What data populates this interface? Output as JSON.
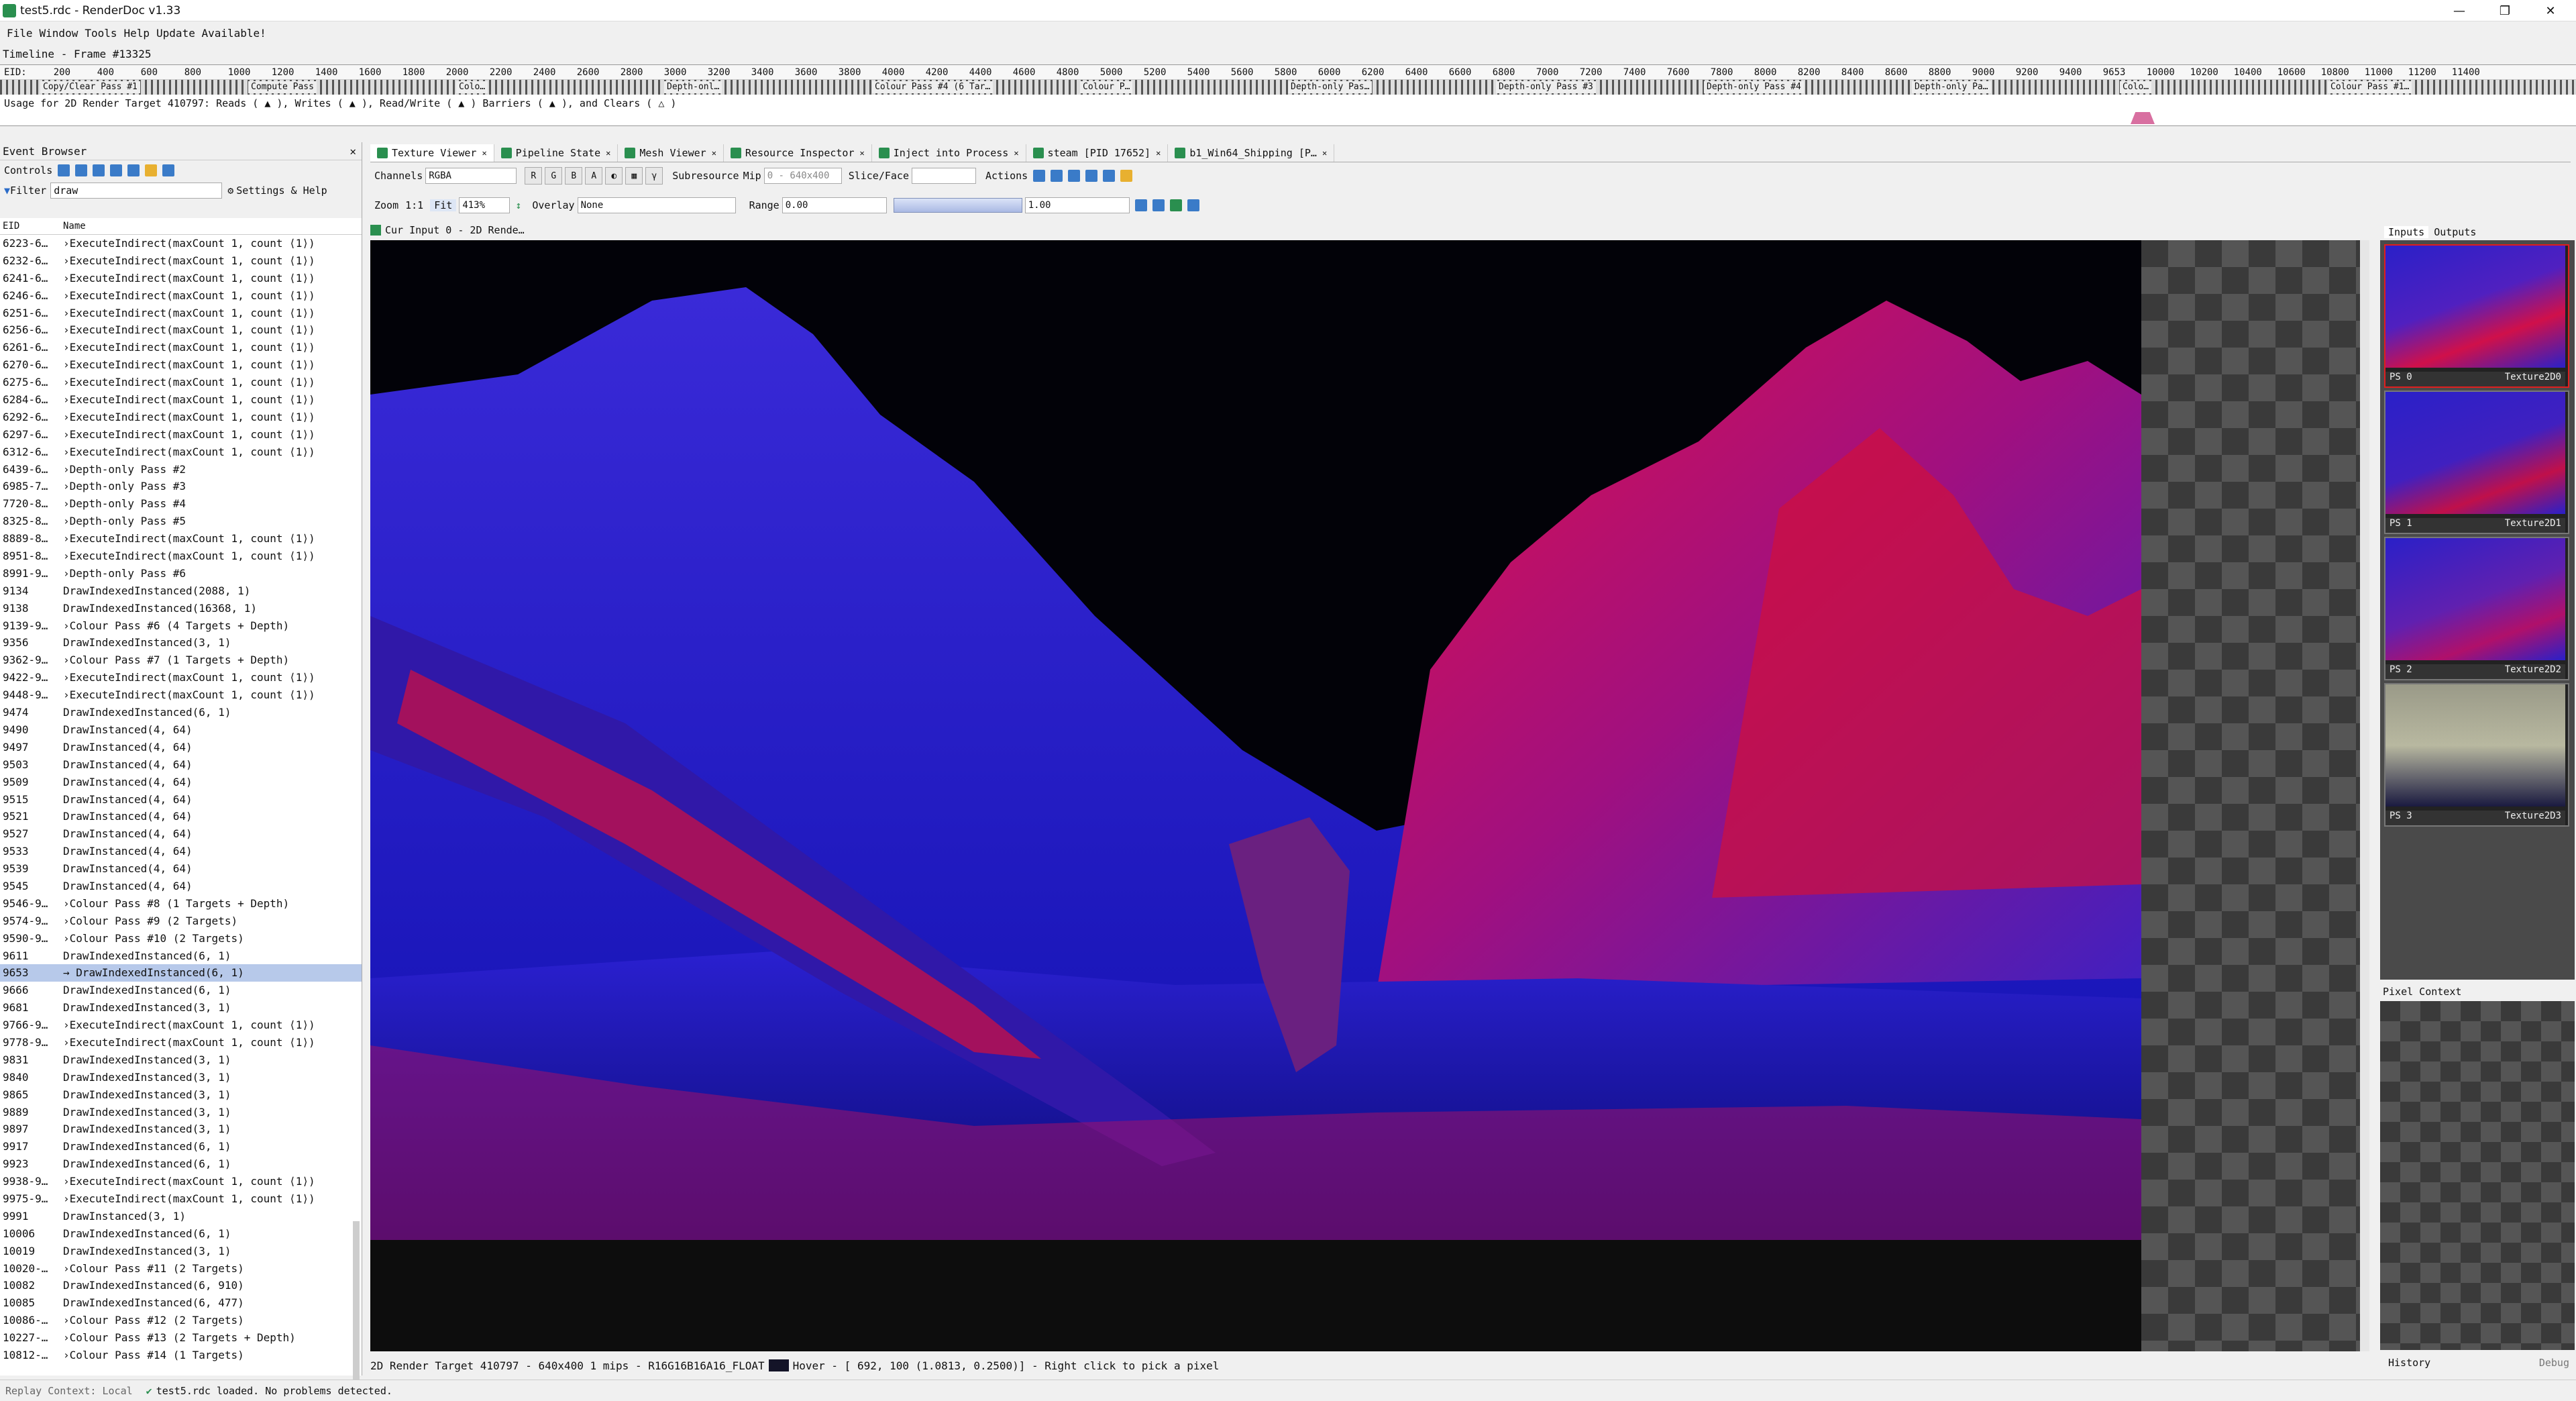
{
  "window": {
    "title": "test5.rdc - RenderDoc v1.33",
    "minimize": "—",
    "maximize": "❐",
    "close": "✕"
  },
  "menu": {
    "file": "File",
    "window": "Window",
    "tools": "Tools",
    "help": "Help",
    "update": "Update Available!"
  },
  "timeline": {
    "header": "Timeline - Frame #13325",
    "eid_label": "EID:",
    "ticks": [
      "200",
      "400",
      "600",
      "800",
      "1000",
      "1200",
      "1400",
      "1600",
      "1800",
      "2000",
      "2200",
      "2400",
      "2600",
      "2800",
      "3000",
      "3200",
      "3400",
      "3600",
      "3800",
      "4000",
      "4200",
      "4400",
      "4600",
      "4800",
      "5000",
      "5200",
      "5400",
      "5600",
      "5800",
      "6000",
      "6200",
      "6400",
      "6600",
      "6800",
      "7000",
      "7200",
      "7400",
      "7600",
      "7800",
      "8000",
      "8200",
      "8400",
      "8600",
      "8800",
      "9000",
      "9200",
      "9400",
      "9653",
      "10000",
      "10200",
      "10400",
      "10600",
      "10800",
      "11000",
      "11200",
      "11400"
    ],
    "passes": [
      "Copy/Clear Pass #1",
      "Compute Pass",
      "Colo…",
      "Depth-onl…",
      "Colour Pass #4 (6 Tar…",
      "Colour P…",
      "Depth-only Pas…",
      "Depth-only Pass #3",
      "Depth-only Pass #4",
      "Depth-only Pa…",
      "Colo…",
      "Colour Pass #1…"
    ],
    "usage": "Usage for 2D Render Target 410797: Reads ( ▲ ), Writes ( ▲ ), Read/Write ( ▲ ) Barriers ( ▲ ), and Clears ( △ )"
  },
  "event_browser": {
    "title": "Event Browser",
    "controls_label": "Controls",
    "filter_label": "Filter",
    "filter_value": "draw",
    "settings_label": "Settings & Help",
    "col_eid": "EID",
    "col_name": "Name",
    "rows": [
      {
        "eid": "6223-6…",
        "name": "›ExecuteIndirect(maxCount 1, count ⟨1⟩)"
      },
      {
        "eid": "6232-6…",
        "name": "›ExecuteIndirect(maxCount 1, count ⟨1⟩)"
      },
      {
        "eid": "6241-6…",
        "name": "›ExecuteIndirect(maxCount 1, count ⟨1⟩)"
      },
      {
        "eid": "6246-6…",
        "name": "›ExecuteIndirect(maxCount 1, count ⟨1⟩)"
      },
      {
        "eid": "6251-6…",
        "name": "›ExecuteIndirect(maxCount 1, count ⟨1⟩)"
      },
      {
        "eid": "6256-6…",
        "name": "›ExecuteIndirect(maxCount 1, count ⟨1⟩)"
      },
      {
        "eid": "6261-6…",
        "name": "›ExecuteIndirect(maxCount 1, count ⟨1⟩)"
      },
      {
        "eid": "6270-6…",
        "name": "›ExecuteIndirect(maxCount 1, count ⟨1⟩)"
      },
      {
        "eid": "6275-6…",
        "name": "›ExecuteIndirect(maxCount 1, count ⟨1⟩)"
      },
      {
        "eid": "6284-6…",
        "name": "›ExecuteIndirect(maxCount 1, count ⟨1⟩)"
      },
      {
        "eid": "6292-6…",
        "name": "›ExecuteIndirect(maxCount 1, count ⟨1⟩)"
      },
      {
        "eid": "6297-6…",
        "name": "›ExecuteIndirect(maxCount 1, count ⟨1⟩)"
      },
      {
        "eid": "6312-6…",
        "name": "›ExecuteIndirect(maxCount 1, count ⟨1⟩)"
      },
      {
        "eid": "6439-6…",
        "name": "›Depth-only Pass #2"
      },
      {
        "eid": "6985-7…",
        "name": "›Depth-only Pass #3"
      },
      {
        "eid": "7720-8…",
        "name": "›Depth-only Pass #4"
      },
      {
        "eid": "8325-8…",
        "name": "›Depth-only Pass #5"
      },
      {
        "eid": "8889-8…",
        "name": "›ExecuteIndirect(maxCount 1, count ⟨1⟩)"
      },
      {
        "eid": "8951-8…",
        "name": "›ExecuteIndirect(maxCount 1, count ⟨1⟩)"
      },
      {
        "eid": "8991-9…",
        "name": "›Depth-only Pass #6"
      },
      {
        "eid": "9134",
        "name": " DrawIndexedInstanced(2088, 1)"
      },
      {
        "eid": "9138",
        "name": " DrawIndexedInstanced(16368, 1)"
      },
      {
        "eid": "9139-9…",
        "name": "›Colour Pass #6 (4 Targets + Depth)"
      },
      {
        "eid": "9356",
        "name": " DrawIndexedInstanced(3, 1)"
      },
      {
        "eid": "9362-9…",
        "name": "›Colour Pass #7 (1 Targets + Depth)"
      },
      {
        "eid": "9422-9…",
        "name": "›ExecuteIndirect(maxCount 1, count ⟨1⟩)"
      },
      {
        "eid": "9448-9…",
        "name": "›ExecuteIndirect(maxCount 1, count ⟨1⟩)"
      },
      {
        "eid": "9474",
        "name": " DrawIndexedInstanced(6, 1)"
      },
      {
        "eid": "9490",
        "name": " DrawInstanced(4, 64)"
      },
      {
        "eid": "9497",
        "name": " DrawInstanced(4, 64)"
      },
      {
        "eid": "9503",
        "name": " DrawInstanced(4, 64)"
      },
      {
        "eid": "9509",
        "name": " DrawInstanced(4, 64)"
      },
      {
        "eid": "9515",
        "name": " DrawInstanced(4, 64)"
      },
      {
        "eid": "9521",
        "name": " DrawInstanced(4, 64)"
      },
      {
        "eid": "9527",
        "name": " DrawInstanced(4, 64)"
      },
      {
        "eid": "9533",
        "name": " DrawInstanced(4, 64)"
      },
      {
        "eid": "9539",
        "name": " DrawInstanced(4, 64)"
      },
      {
        "eid": "9545",
        "name": " DrawInstanced(4, 64)"
      },
      {
        "eid": "9546-9…",
        "name": "›Colour Pass #8 (1 Targets + Depth)"
      },
      {
        "eid": "9574-9…",
        "name": "›Colour Pass #9 (2 Targets)"
      },
      {
        "eid": "9590-9…",
        "name": "›Colour Pass #10 (2 Targets)"
      },
      {
        "eid": "9611",
        "name": " DrawIndexedInstanced(6, 1)"
      },
      {
        "eid": "9653",
        "name": " → DrawIndexedInstanced(6, 1)",
        "selected": true
      },
      {
        "eid": "9666",
        "name": " DrawIndexedInstanced(6, 1)"
      },
      {
        "eid": "9681",
        "name": " DrawIndexedInstanced(3, 1)"
      },
      {
        "eid": "9766-9…",
        "name": "›ExecuteIndirect(maxCount 1, count ⟨1⟩)"
      },
      {
        "eid": "9778-9…",
        "name": "›ExecuteIndirect(maxCount 1, count ⟨1⟩)"
      },
      {
        "eid": "9831",
        "name": " DrawIndexedInstanced(3, 1)"
      },
      {
        "eid": "9840",
        "name": " DrawIndexedInstanced(3, 1)"
      },
      {
        "eid": "9865",
        "name": " DrawIndexedInstanced(3, 1)"
      },
      {
        "eid": "9889",
        "name": " DrawIndexedInstanced(3, 1)"
      },
      {
        "eid": "9897",
        "name": " DrawIndexedInstanced(3, 1)"
      },
      {
        "eid": "9917",
        "name": " DrawIndexedInstanced(6, 1)"
      },
      {
        "eid": "9923",
        "name": " DrawIndexedInstanced(6, 1)"
      },
      {
        "eid": "9938-9…",
        "name": "›ExecuteIndirect(maxCount 1, count ⟨1⟩)"
      },
      {
        "eid": "9975-9…",
        "name": "›ExecuteIndirect(maxCount 1, count ⟨1⟩)"
      },
      {
        "eid": "9991",
        "name": " DrawInstanced(3, 1)"
      },
      {
        "eid": "10006",
        "name": " DrawIndexedInstanced(6, 1)"
      },
      {
        "eid": "10019",
        "name": " DrawIndexedInstanced(3, 1)"
      },
      {
        "eid": "10020-…",
        "name": "›Colour Pass #11 (2 Targets)"
      },
      {
        "eid": "10082",
        "name": " DrawIndexedInstanced(6, 910)"
      },
      {
        "eid": "10085",
        "name": " DrawIndexedInstanced(6, 477)"
      },
      {
        "eid": "10086-…",
        "name": "›Colour Pass #12 (2 Targets)"
      },
      {
        "eid": "10227-…",
        "name": "›Colour Pass #13 (2 Targets + Depth)"
      },
      {
        "eid": "10812-…",
        "name": "›Colour Pass #14 (1 Targets)"
      }
    ]
  },
  "tabs": [
    {
      "label": "Texture Viewer",
      "active": true
    },
    {
      "label": "Pipeline State"
    },
    {
      "label": "Mesh Viewer"
    },
    {
      "label": "Resource Inspector"
    },
    {
      "label": "Inject into Process"
    },
    {
      "label": "steam [PID 17652]"
    },
    {
      "label": "b1_Win64_Shipping [P…"
    }
  ],
  "toolbar": {
    "channels_label": "Channels",
    "channels_value": "RGBA",
    "r": "R",
    "g": "G",
    "b": "B",
    "a": "A",
    "subresource_label": "Subresource",
    "mip_label": "Mip",
    "mip_value": "0 - 640x400",
    "slice_label": "Slice/Face",
    "actions_label": "Actions",
    "zoom_label": "Zoom",
    "zoom_11": "1:1",
    "fit": "Fit",
    "zoom_value": "413%",
    "overlay_label": "Overlay",
    "overlay_value": "None",
    "range_label": "Range",
    "range_min": "0.00",
    "range_max": "1.00"
  },
  "viewer": {
    "tab_label": "Cur Input 0 - 2D Rende…"
  },
  "thumbnails": {
    "inputs_tab": "Inputs",
    "outputs_tab": "Outputs",
    "items": [
      {
        "slot": "PS 0",
        "name": "Texture2D0",
        "selected": true
      },
      {
        "slot": "PS 1",
        "name": "Texture2D1"
      },
      {
        "slot": "PS 2",
        "name": "Texture2D2"
      },
      {
        "slot": "PS 3",
        "name": "Texture2D3"
      }
    ]
  },
  "pixel_context": {
    "title": "Pixel Context",
    "history": "History",
    "debug": "Debug"
  },
  "status": {
    "hover": "2D Render Target 410797 - 640x400 1 mips - R16G16B16A16_FLOAT",
    "hover_pos": "Hover - [ 692,  100 (1.0813, 0.2500)] - Right click to pick a pixel",
    "replay": "Replay Context: Local",
    "loaded": "test5.rdc loaded. No problems detected."
  },
  "colors": {
    "accent": "#2a8f4f",
    "selection": "#b7c9ea",
    "thumb_selected_border": "#e01e1e"
  }
}
